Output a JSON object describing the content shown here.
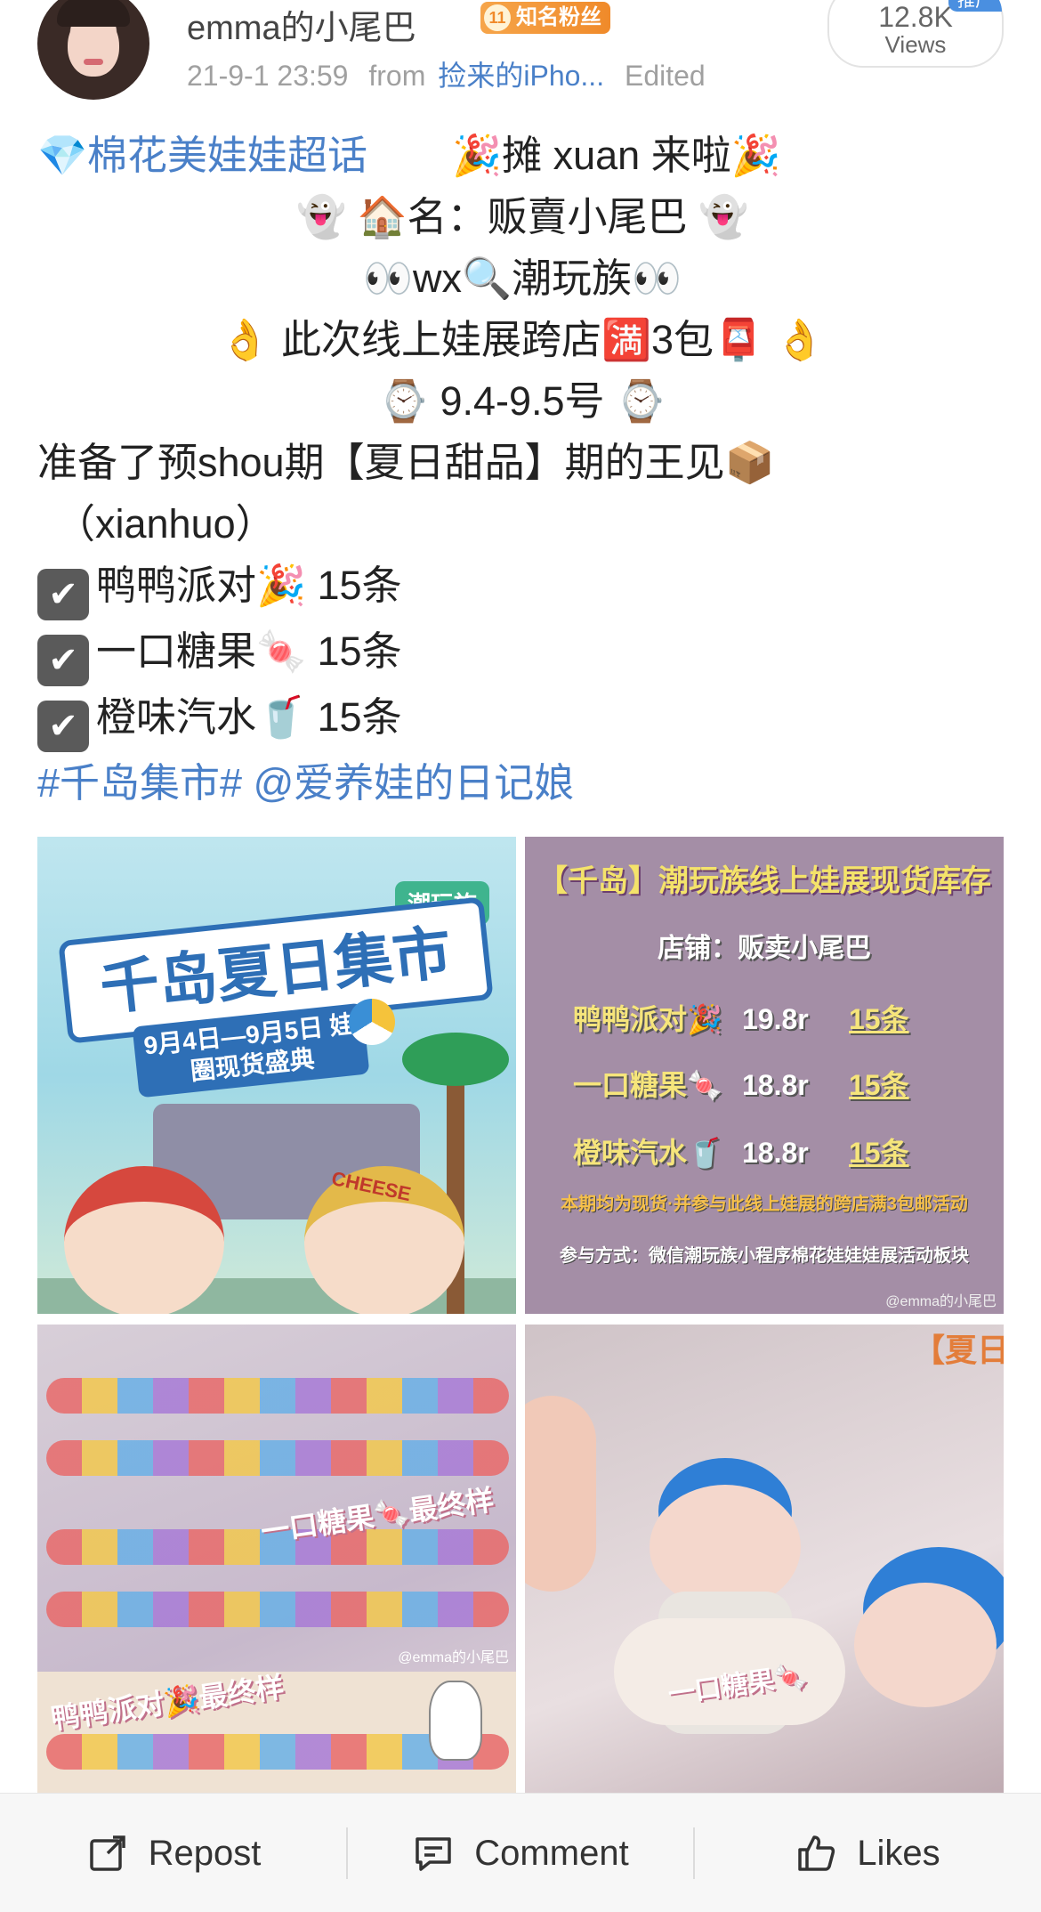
{
  "user": {
    "name": "emma的小尾巴",
    "badge_level": "11",
    "badge_text": "知名粉丝",
    "timestamp": "21-9-1 23:59",
    "from_label": "from",
    "source": "捡来的iPho...",
    "edited": "Edited"
  },
  "views": {
    "count": "12.8K",
    "label": "Views",
    "tag": "推广"
  },
  "post": {
    "topic": "棉花美娃娃超话",
    "line1": "🎉摊 xuan 来啦🎉",
    "line2": "👻 🏠名：贩賣小尾巴 👻",
    "line3": "👀wx🔍潮玩族👀",
    "line4": "👌 此次线上娃展跨店🈵3包📮 👌",
    "line5": "⌚ 9.4-9.5号 ⌚",
    "line6": "准备了预shou期【夏日甜品】期的王见📦",
    "line7": "（xianhuo）",
    "items": [
      {
        "check": "✔",
        "text": "鸭鸭派对🎉 15条"
      },
      {
        "check": "✔",
        "text": "一口糖果🍬 15条"
      },
      {
        "check": "✔",
        "text": "橙味汽水🥤 15条"
      }
    ],
    "hashtag": "#千岛集市#",
    "mention": "@爱养娃的日记娘"
  },
  "images": {
    "poster1": {
      "brand": "潮玩族",
      "title": "千岛夏日集市",
      "subtitle": "9月4日—9月5日 娃圈现货盛典",
      "hat_text": "CHEESE"
    },
    "poster2": {
      "title": "【千岛】潮玩族线上娃展现货库存",
      "shop": "店铺：贩卖小尾巴",
      "rows": [
        {
          "name": "鸭鸭派对🎉",
          "price": "19.8r",
          "qty": "15条"
        },
        {
          "name": "一口糖果🍬",
          "price": "18.8r",
          "qty": "15条"
        },
        {
          "name": "橙味汽水🥤",
          "price": "18.8r",
          "qty": "15条"
        }
      ],
      "note1": "本期均为现货·并参与此线上娃展的跨店满3包邮活动",
      "note2": "参与方式：微信潮玩族小程序棉花娃娃娃展活动板块",
      "watermark": "@emma的小尾巴"
    },
    "photo3": {
      "caption1": "一口糖果🍬最终样",
      "caption2": "鸭鸭派对🎉最终样",
      "watermark": "@emma的小尾巴"
    },
    "photo4": {
      "caption": "一口糖果🍬",
      "corner": "【夏日"
    }
  },
  "actions": {
    "repost": "Repost",
    "comment": "Comment",
    "likes": "Likes"
  },
  "colors": {
    "link_blue": "#4a80c8",
    "badge_orange": "#f08a2a",
    "meta_gray": "#a0a0a0"
  }
}
